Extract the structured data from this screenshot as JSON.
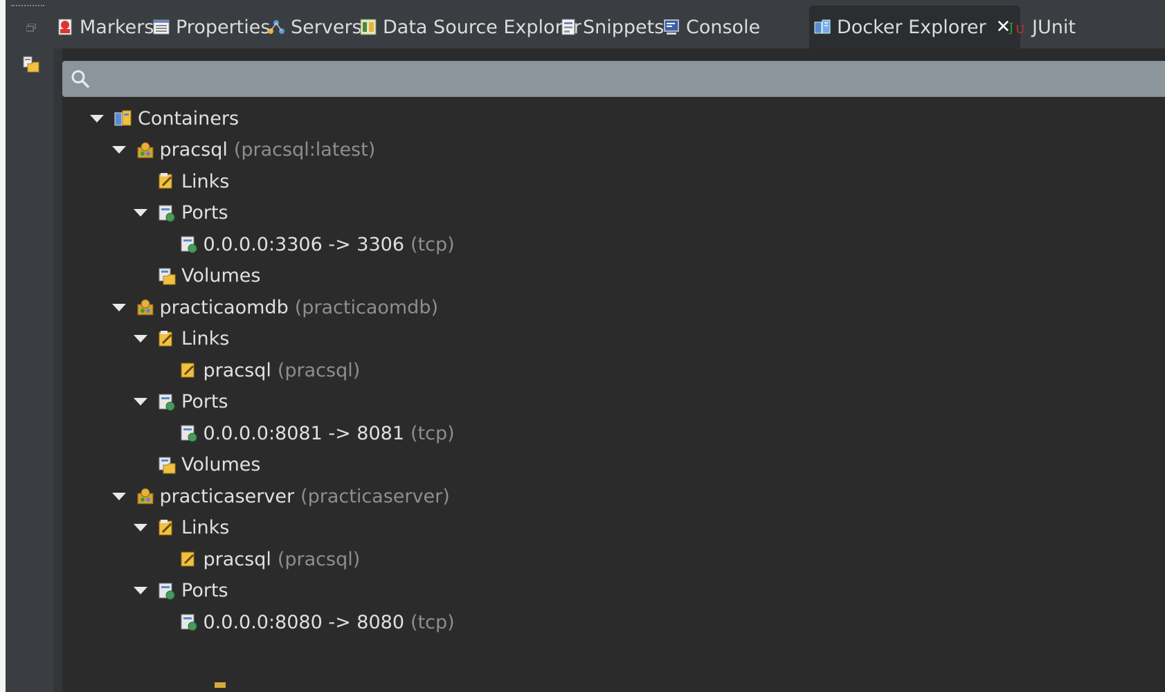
{
  "tabs": [
    {
      "label": "Markers",
      "icon": "markers-icon"
    },
    {
      "label": "Properties",
      "icon": "properties-icon"
    },
    {
      "label": "Servers",
      "icon": "servers-icon"
    },
    {
      "label": "Data Source Explorer",
      "icon": "data-source-explorer-icon"
    },
    {
      "label": "Snippets",
      "icon": "snippets-icon"
    },
    {
      "label": "Console",
      "icon": "console-icon"
    },
    {
      "label": "Docker Explorer",
      "icon": "docker-explorer-icon",
      "active": true
    },
    {
      "label": "JUnit",
      "icon": "junit-icon"
    }
  ],
  "search": {
    "placeholder": "",
    "value": ""
  },
  "tree": [
    {
      "label": "Containers",
      "detail": "",
      "icon": "containers-icon",
      "expanded": true
    },
    {
      "label": "pracsql",
      "detail": "(pracsql:latest)",
      "icon": "container-icon",
      "expanded": true
    },
    {
      "label": "Links",
      "detail": "",
      "icon": "links-icon",
      "expanded": false
    },
    {
      "label": "Ports",
      "detail": "",
      "icon": "ports-icon",
      "expanded": true
    },
    {
      "label": "0.0.0.0:3306 -> 3306",
      "detail": "(tcp)",
      "icon": "port-icon",
      "expanded": false
    },
    {
      "label": "Volumes",
      "detail": "",
      "icon": "volumes-icon",
      "expanded": false
    },
    {
      "label": "practicaomdb",
      "detail": "(practicaomdb)",
      "icon": "container-icon",
      "expanded": true
    },
    {
      "label": "Links",
      "detail": "",
      "icon": "links-icon",
      "expanded": true
    },
    {
      "label": "pracsql",
      "detail": "(pracsql)",
      "icon": "link-icon",
      "expanded": false
    },
    {
      "label": "Ports",
      "detail": "",
      "icon": "ports-icon",
      "expanded": true
    },
    {
      "label": "0.0.0.0:8081 -> 8081",
      "detail": "(tcp)",
      "icon": "port-icon",
      "expanded": false
    },
    {
      "label": "Volumes",
      "detail": "",
      "icon": "volumes-icon",
      "expanded": false
    },
    {
      "label": "practicaserver",
      "detail": "(practicaserver)",
      "icon": "container-icon",
      "expanded": true
    },
    {
      "label": "Links",
      "detail": "",
      "icon": "links-icon",
      "expanded": true
    },
    {
      "label": "pracsql",
      "detail": "(pracsql)",
      "icon": "link-icon",
      "expanded": false
    },
    {
      "label": "Ports",
      "detail": "",
      "icon": "ports-icon",
      "expanded": true
    },
    {
      "label": "0.0.0.0:8080 -> 8080",
      "detail": "(tcp)",
      "icon": "port-icon",
      "expanded": false
    }
  ],
  "colors": {
    "background": "#2b2b2b",
    "tabbar": "#3a3d41",
    "text": "#e0e0e0",
    "detail_text": "#8e8e8e",
    "search_bg": "#8c949c"
  }
}
